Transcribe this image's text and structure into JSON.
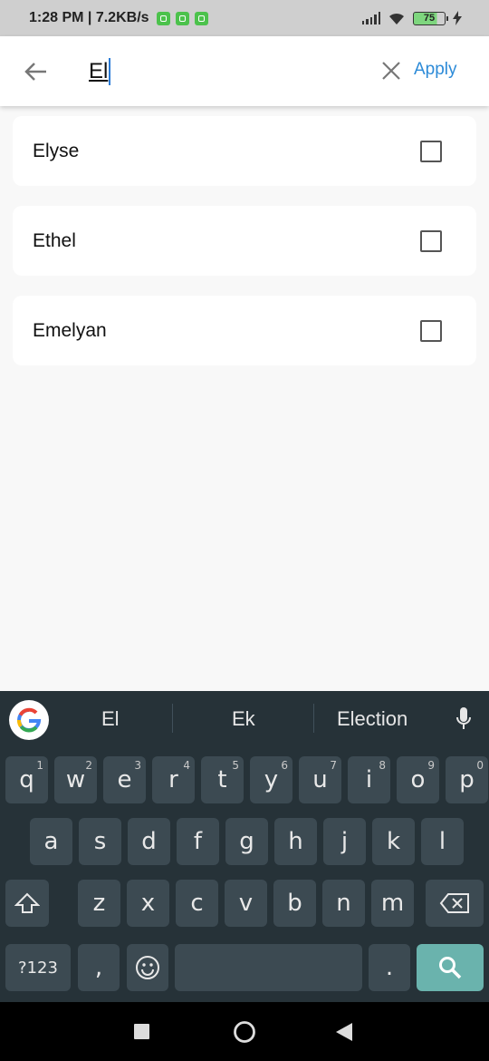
{
  "status_bar": {
    "time": "1:28 PM | 7.2KB/s",
    "battery": "75"
  },
  "search": {
    "query": "El",
    "apply_label": "Apply"
  },
  "items": [
    {
      "label": "Elyse",
      "checked": false
    },
    {
      "label": "Ethel",
      "checked": false
    },
    {
      "label": "Emelyan",
      "checked": false
    }
  ],
  "keyboard": {
    "suggestions": [
      "El",
      "Ek",
      "Election"
    ],
    "row1": [
      {
        "key": "q",
        "num": "1"
      },
      {
        "key": "w",
        "num": "2"
      },
      {
        "key": "e",
        "num": "3"
      },
      {
        "key": "r",
        "num": "4"
      },
      {
        "key": "t",
        "num": "5"
      },
      {
        "key": "y",
        "num": "6"
      },
      {
        "key": "u",
        "num": "7"
      },
      {
        "key": "i",
        "num": "8"
      },
      {
        "key": "o",
        "num": "9"
      },
      {
        "key": "p",
        "num": "0"
      }
    ],
    "row2": [
      "a",
      "s",
      "d",
      "f",
      "g",
      "h",
      "j",
      "k",
      "l"
    ],
    "row3": [
      "z",
      "x",
      "c",
      "v",
      "b",
      "n",
      "m"
    ],
    "symbols_label": "?123",
    "comma_label": ",",
    "period_label": "."
  }
}
